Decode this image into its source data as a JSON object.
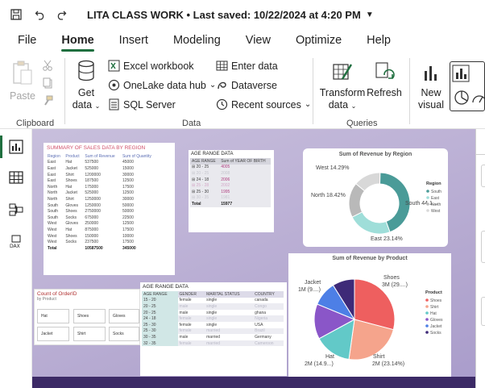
{
  "window": {
    "title": "LITA CLASS WORK",
    "saved_status": "• Last saved: 10/22/2024 at 4:20 PM"
  },
  "menu": {
    "items": [
      "File",
      "Home",
      "Insert",
      "Modeling",
      "View",
      "Optimize",
      "Help"
    ],
    "active": "Home"
  },
  "ribbon": {
    "clipboard": {
      "paste": "Paste",
      "group": "Clipboard"
    },
    "data": {
      "get_data_1": "Get",
      "get_data_2": "data",
      "excel": "Excel workbook",
      "onelake": "OneLake data hub",
      "sql": "SQL Server",
      "enter_data": "Enter data",
      "dataverse": "Dataverse",
      "recent": "Recent sources",
      "group": "Data"
    },
    "queries": {
      "transform_1": "Transform",
      "transform_2": "data",
      "refresh": "Refresh",
      "group": "Queries"
    },
    "insert": {
      "new_visual_1": "New",
      "new_visual_2": "visual"
    }
  },
  "report": {
    "summary_table": {
      "title": "SUMMARY OF SALES DATA BY REGION",
      "headers": [
        "Region",
        "Product",
        "Sum of Revenue",
        "Sum of Quantity"
      ],
      "rows": [
        [
          "East",
          "Hat",
          "537500",
          "45000"
        ],
        [
          "East",
          "Jacket",
          "525000",
          "15000"
        ],
        [
          "East",
          "Shirt",
          "1200000",
          "30000"
        ],
        [
          "East",
          "Shoes",
          "187500",
          "12500"
        ],
        [
          "North",
          "Hat",
          "175000",
          "17500"
        ],
        [
          "North",
          "Jacket",
          "525000",
          "12500"
        ],
        [
          "North",
          "Shirt",
          "1250000",
          "30000"
        ],
        [
          "South",
          "Gloves",
          "1250000",
          "50000"
        ],
        [
          "South",
          "Shoes",
          "2750000",
          "50000"
        ],
        [
          "South",
          "Socks",
          "675000",
          "22500"
        ],
        [
          "West",
          "Gloves",
          "250000",
          "12500"
        ],
        [
          "West",
          "Hat",
          "875000",
          "17500"
        ],
        [
          "West",
          "Shoes",
          "150000",
          "10000"
        ],
        [
          "West",
          "Socks",
          "237500",
          "17500"
        ]
      ],
      "total": [
        "Total",
        "",
        "10587500",
        "345000"
      ]
    },
    "age_range_small": {
      "title": "AGE RANGE DATA",
      "headers": [
        "AGE RANGE",
        "Sum of YEAR OF BIRTH"
      ],
      "rows": [
        [
          "20 - 25",
          "4005"
        ],
        [
          "20 - 25",
          "2008"
        ],
        [
          "24 - 18",
          "2006"
        ],
        [
          "25 - 28",
          "2002"
        ],
        [
          "25 - 30",
          "1995"
        ],
        [
          "30 - 35",
          "1981"
        ]
      ],
      "total": [
        "Total",
        "15977"
      ]
    },
    "region_donut": {
      "title": "Sum of Revenue by Region",
      "legend_title": "Region",
      "labels": [
        "West 14.29%",
        "North 18.42%",
        "South 44.1…",
        "East 23.14%"
      ],
      "legend": [
        "South",
        "East",
        "North",
        "West"
      ]
    },
    "count_card": {
      "title": "Count of OrderID",
      "subtitle": "by Product",
      "items": [
        "Hat",
        "Shoes",
        "Gloves",
        "Jacket",
        "Shirt",
        "Socks"
      ]
    },
    "age_range_big": {
      "title": "AGE RANGE DATA",
      "headers": [
        "AGE RANGE",
        "GENDER",
        "MARITAL STATUS",
        "COUNTRY"
      ],
      "rows": [
        [
          "15 - 20",
          "female",
          "single",
          "canada"
        ],
        [
          "20 - 25",
          "male",
          "single",
          "Congo"
        ],
        [
          "20 - 25",
          "male",
          "single",
          "ghana"
        ],
        [
          "24 - 18",
          "female",
          "single",
          "Nigeria"
        ],
        [
          "25 - 30",
          "female",
          "single",
          "USA"
        ],
        [
          "25 - 30",
          "female",
          "married",
          "Brazil"
        ],
        [
          "30 - 35",
          "male",
          "married",
          "Germany"
        ],
        [
          "32 - 35",
          "female",
          "married",
          "Cameroon"
        ]
      ]
    },
    "product_pie": {
      "title": "Sum of Revenue by Product",
      "legend_title": "Product",
      "labels": [
        "Jacket\n1M (9....)",
        "Shoes\n3M (29....)",
        "Hat\n2M (14.9...)",
        "Shirt\n2M (23.14%)"
      ],
      "legend": [
        "Shoes",
        "Shirt",
        "Hat",
        "Gloves",
        "Jacket",
        "Socks"
      ]
    }
  },
  "colors": {
    "accent": "#1f6f3f",
    "canvas_bg": "#bdb2d6",
    "south": "#4a9b98",
    "east": "#9fded9",
    "north": "#b9b9b9",
    "west": "#d8d8d8",
    "shoes": "#ee5f5f",
    "shirt": "#f5a48c",
    "hat": "#62c9c8",
    "gloves": "#8a56c8",
    "jacket": "#4d7fe6",
    "socks": "#3e2a78"
  },
  "chart_data": [
    {
      "type": "pie",
      "title": "Sum of Revenue by Region",
      "categories": [
        "South",
        "East",
        "North",
        "West"
      ],
      "values": [
        44.1,
        23.14,
        18.42,
        14.29
      ]
    },
    {
      "type": "pie",
      "title": "Sum of Revenue by Product",
      "categories": [
        "Shoes",
        "Shirt",
        "Hat",
        "Gloves",
        "Jacket",
        "Socks"
      ],
      "values": [
        29.1,
        23.14,
        14.9,
        14.1,
        9.9,
        8.9
      ]
    }
  ]
}
